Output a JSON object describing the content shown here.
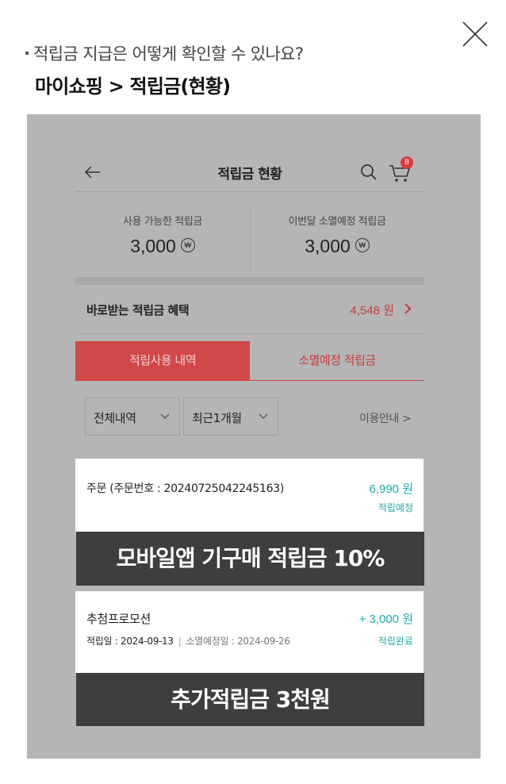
{
  "help": {
    "question": "적립금 지급은 어떻게 확인할 수 있나요?",
    "path": "마이쇼핑 > 적립금(현황)"
  },
  "header": {
    "title": "적립금 현황",
    "cart_badge": "8"
  },
  "balances": {
    "available_label": "사용 가능한 적립금",
    "available_value": "3,000",
    "expiring_label": "이번달 소멸예정 적립금",
    "expiring_value": "3,000",
    "currency_mark": "₩"
  },
  "reward": {
    "label": "바로받는 적립금 혜택",
    "value": "4,548 원"
  },
  "tabs": [
    {
      "label": "적립사용 내역",
      "active": true
    },
    {
      "label": "소멸예정 적립금",
      "active": false
    }
  ],
  "filters": {
    "type_selected": "전체내역",
    "period_selected": "최근1개월",
    "guide_link": "이용안내 >"
  },
  "entries": [
    {
      "title": "주문 (주문번호 : 20240725042245163)",
      "amount": "6,990 원",
      "status": "적립예정"
    },
    {
      "title": "추첨프로모션",
      "amount": "+ 3,000 원",
      "accrual_date": "적립일 : 2024-09-13",
      "expire_date": "소멸예정일 : 2024-09-26",
      "status": "적립완료"
    }
  ],
  "banners": {
    "app_purchase": "모바일앱 기구매 적립금 10%",
    "extra": "추가적립금 3천원"
  },
  "colors": {
    "accent_red": "#d14848",
    "teal": "#22a8a8",
    "overlay_gray": "#b5b5b5",
    "banner_dark": "#3e3e3e"
  }
}
